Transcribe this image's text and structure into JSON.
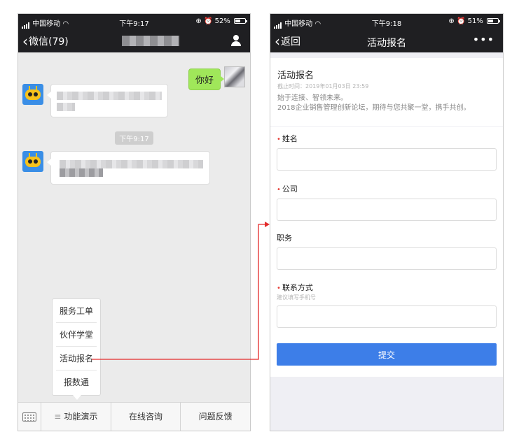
{
  "left_phone": {
    "status": {
      "carrier": "中国移动",
      "time": "下午9:17",
      "battery": "52%",
      "battery_level": 0.52
    },
    "nav": {
      "back_label": "微信(79)",
      "title": ""
    },
    "messages": {
      "outgoing_text": "你好",
      "timestamp": "下午9:17"
    },
    "popup_menu": {
      "items": [
        "服务工单",
        "伙伴学堂",
        "活动报名",
        "报数通"
      ]
    },
    "bottom_bar": {
      "items": [
        "功能演示",
        "在线咨询",
        "问题反馈"
      ],
      "menu_glyph": "≡"
    }
  },
  "right_phone": {
    "status": {
      "carrier": "中国移动",
      "time": "下午9:18",
      "battery": "51%",
      "battery_level": 0.51
    },
    "nav": {
      "back_label": "返回",
      "title": "活动报名",
      "more": "•••"
    },
    "form": {
      "title": "活动报名",
      "deadline": "截止时间：2019年01月03日 23:59",
      "description_line1": "始于连接、智领未来。",
      "description_line2": "2018企业销售管理创新论坛，期待与您共聚一堂，携手共创。",
      "fields": [
        {
          "label": "姓名",
          "required": true,
          "hint": "",
          "value": ""
        },
        {
          "label": "公司",
          "required": true,
          "hint": "",
          "value": ""
        },
        {
          "label": "职务",
          "required": false,
          "hint": "",
          "value": ""
        },
        {
          "label": "联系方式",
          "required": true,
          "hint": "建议填写手机号",
          "value": ""
        }
      ],
      "required_mark": "•",
      "submit_label": "提交"
    }
  },
  "colors": {
    "arrow": "#e32a2a",
    "submit": "#3d7ee8",
    "bubble_out": "#a0e75a"
  }
}
